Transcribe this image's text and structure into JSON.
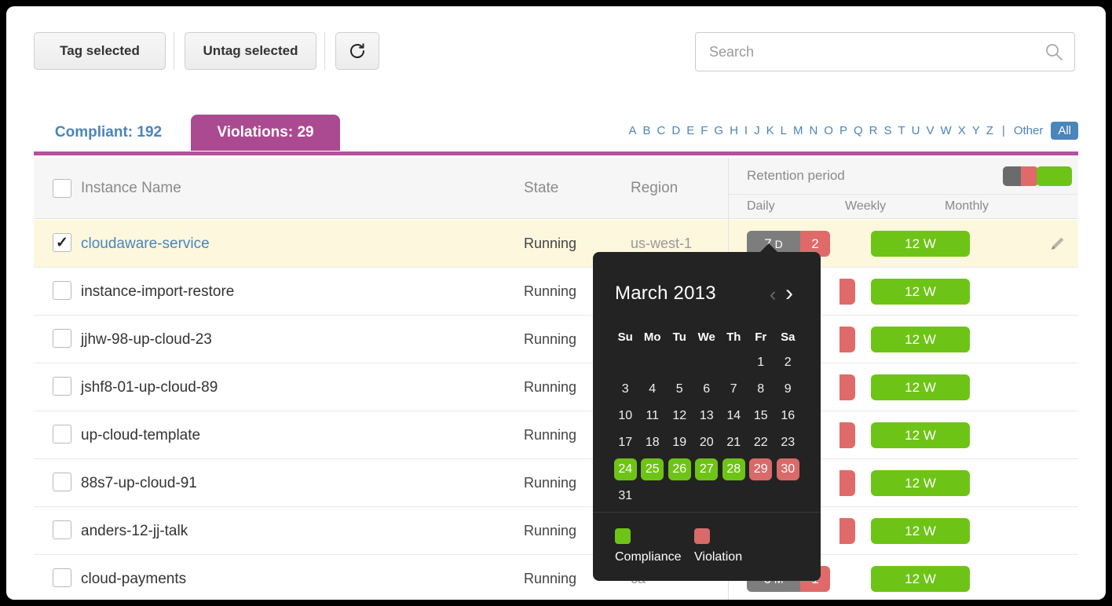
{
  "toolbar": {
    "tag_selected_label": "Tag selected",
    "untag_selected_label": "Untag selected",
    "refresh_icon": "refresh-icon"
  },
  "search": {
    "value": "",
    "placeholder": "Search",
    "icon": "search-icon"
  },
  "tabs": [
    {
      "label": "Compliant: 192",
      "active": false
    },
    {
      "label": "Violations: 29",
      "active": true
    }
  ],
  "alphabet": {
    "letters": [
      "A",
      "B",
      "C",
      "D",
      "E",
      "F",
      "G",
      "H",
      "I",
      "J",
      "K",
      "L",
      "M",
      "N",
      "O",
      "P",
      "Q",
      "R",
      "S",
      "T",
      "U",
      "V",
      "W",
      "X",
      "Y",
      "Z"
    ],
    "separator": "|",
    "other_label": "Other",
    "all_label": "All"
  },
  "table": {
    "headers": {
      "instance_name": "Instance Name",
      "state": "State",
      "region": "Region",
      "retention_period": "Retention period"
    },
    "subheaders": {
      "daily": "Daily",
      "weekly": "Weekly",
      "monthly": "Monthly"
    },
    "rows": [
      {
        "name": "cloudaware-service",
        "state": "Running",
        "region": "us-west-1",
        "checked": true,
        "selected": true,
        "daily_value": "7",
        "daily_unit": "D",
        "daily_count": "2",
        "weekly_value": "12 W",
        "has_edit": true
      },
      {
        "name": "instance-import-restore",
        "state": "Running",
        "region": "",
        "checked": false,
        "selected": false,
        "daily_value": "",
        "daily_unit": "",
        "daily_count": "",
        "weekly_value": "12 W",
        "has_edit": false
      },
      {
        "name": " jjhw-98-up-cloud-23",
        "state": "Running",
        "region": "",
        "checked": false,
        "selected": false,
        "daily_value": "",
        "daily_unit": "",
        "daily_count": "",
        "weekly_value": "12 W",
        "has_edit": false
      },
      {
        "name": "jshf8-01-up-cloud-89",
        "state": "Running",
        "region": "",
        "checked": false,
        "selected": false,
        "daily_value": "",
        "daily_unit": "",
        "daily_count": "",
        "weekly_value": "12 W",
        "has_edit": false
      },
      {
        "name": "up-cloud-template",
        "state": "Running",
        "region": "",
        "checked": false,
        "selected": false,
        "daily_value": "",
        "daily_unit": "",
        "daily_count": "",
        "weekly_value": "12 W",
        "has_edit": false
      },
      {
        "name": " 88s7-up-cloud-91",
        "state": "Running",
        "region": "",
        "checked": false,
        "selected": false,
        "daily_value": "",
        "daily_unit": "",
        "daily_count": "",
        "weekly_value": "12 W",
        "has_edit": false
      },
      {
        "name": "anders-12-jj-talk",
        "state": "Running",
        "region": "",
        "checked": false,
        "selected": false,
        "daily_value": "",
        "daily_unit": "",
        "daily_count": "",
        "weekly_value": "12 W",
        "has_edit": false
      },
      {
        "name": "cloud-payments",
        "state": "Running",
        "region": "ca",
        "checked": false,
        "selected": false,
        "daily_value": "6",
        "daily_unit": "M",
        "daily_count": "1",
        "weekly_value": "12 W",
        "has_edit": false
      }
    ]
  },
  "calendar": {
    "title": "March 2013",
    "prev_icon": "chevron-left-icon",
    "next_icon": "chevron-right-icon",
    "prev_glyph": "‹",
    "next_glyph": "›",
    "dow": [
      "Su",
      "Mo",
      "Tu",
      "We",
      "Th",
      "Fr",
      "Sa"
    ],
    "lead_blanks": 5,
    "days": [
      {
        "n": "1",
        "s": "none"
      },
      {
        "n": "2",
        "s": "none"
      },
      {
        "n": "3",
        "s": "none"
      },
      {
        "n": "4",
        "s": "none"
      },
      {
        "n": "5",
        "s": "none"
      },
      {
        "n": "6",
        "s": "none"
      },
      {
        "n": "7",
        "s": "none"
      },
      {
        "n": "8",
        "s": "none"
      },
      {
        "n": "9",
        "s": "none"
      },
      {
        "n": "10",
        "s": "none"
      },
      {
        "n": "11",
        "s": "none"
      },
      {
        "n": "12",
        "s": "none"
      },
      {
        "n": "13",
        "s": "none"
      },
      {
        "n": "14",
        "s": "none"
      },
      {
        "n": "15",
        "s": "none"
      },
      {
        "n": "16",
        "s": "none"
      },
      {
        "n": "17",
        "s": "none"
      },
      {
        "n": "18",
        "s": "none"
      },
      {
        "n": "19",
        "s": "none"
      },
      {
        "n": "20",
        "s": "none"
      },
      {
        "n": "21",
        "s": "none"
      },
      {
        "n": "22",
        "s": "none"
      },
      {
        "n": "23",
        "s": "none"
      },
      {
        "n": "24",
        "s": "ok"
      },
      {
        "n": "25",
        "s": "ok"
      },
      {
        "n": "26",
        "s": "ok"
      },
      {
        "n": "27",
        "s": "ok"
      },
      {
        "n": "28",
        "s": "ok"
      },
      {
        "n": "29",
        "s": "bad"
      },
      {
        "n": "30",
        "s": "bad"
      },
      {
        "n": "31",
        "s": "none"
      }
    ],
    "legend": {
      "compliance_label": "Compliance",
      "violation_label": "Violation"
    }
  },
  "colors": {
    "accent_magenta": "#ab4a90",
    "link_blue": "#4a85bb",
    "green": "#6ec416",
    "red": "#e06a6a",
    "gray_badge": "#7d7d7d",
    "selected_row": "#fdf7dd",
    "popup_bg": "#232323"
  }
}
